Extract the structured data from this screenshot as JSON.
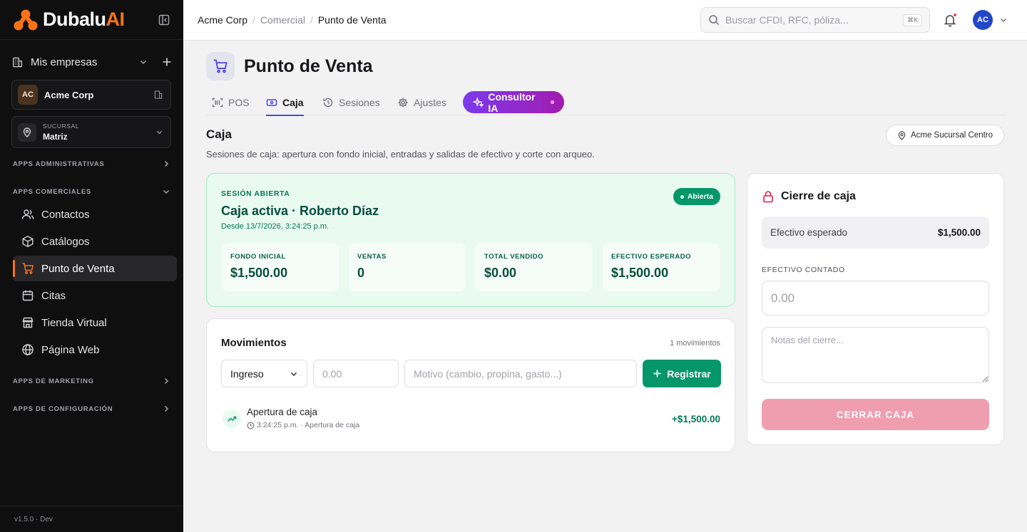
{
  "brand": {
    "name": "Dubalu",
    "suffix": "AI",
    "accent": "#f97316"
  },
  "sidebar": {
    "companies_label": "Mis empresas",
    "company": {
      "initials": "AC",
      "name": "Acme Corp"
    },
    "branch": {
      "caption": "SUCURSAL",
      "value": "Matriz"
    },
    "sections": {
      "admin": "APPS ADMINISTRATIVAS",
      "commercial": "APPS COMERCIALES",
      "marketing": "APPS DE MARKETING",
      "config": "APPS DE CONFIGURACIÓN"
    },
    "items": [
      {
        "label": "Contactos",
        "icon": "users-icon"
      },
      {
        "label": "Catálogos",
        "icon": "box-icon"
      },
      {
        "label": "Punto de Venta",
        "icon": "cart-icon",
        "active": true
      },
      {
        "label": "Citas",
        "icon": "calendar-icon"
      },
      {
        "label": "Tienda Virtual",
        "icon": "store-icon"
      },
      {
        "label": "Página Web",
        "icon": "globe-icon"
      }
    ],
    "version": "v1.5.0 · Dev"
  },
  "topbar": {
    "breadcrumb": [
      "Acme Corp",
      "Comercial",
      "Punto de Venta"
    ],
    "search_placeholder": "Buscar CFDI, RFC, póliza...",
    "search_shortcut": "⌘K",
    "user_initials": "AC"
  },
  "page": {
    "title": "Punto de Venta",
    "tabs": [
      "POS",
      "Caja",
      "Sesiones",
      "Ajustes"
    ],
    "active_tab": "Caja",
    "ai_tab": "Consultor IA"
  },
  "caja": {
    "title": "Caja",
    "description": "Sesiones de caja: apertura con fondo inicial, entradas y salidas de efectivo y corte con arqueo.",
    "branch_pill": "Acme Sucursal Centro",
    "session": {
      "caption": "SESIÓN ABIERTA",
      "title": "Caja activa · Roberto Díaz",
      "since": "Desde 13/7/2026, 3:24:25 p.m.",
      "status": "Abierta",
      "stats": [
        {
          "label": "FONDO INICIAL",
          "value": "$1,500.00"
        },
        {
          "label": "VENTAS",
          "value": "0"
        },
        {
          "label": "TOTAL VENDIDO",
          "value": "$0.00"
        },
        {
          "label": "EFECTIVO ESPERADO",
          "value": "$1,500.00"
        }
      ]
    },
    "movements": {
      "title": "Movimientos",
      "count": "1 movimientos",
      "type_selected": "Ingreso",
      "amount_placeholder": "0.00",
      "reason_placeholder": "Motivo (cambio, propina, gasto...)",
      "register_label": "Registrar",
      "rows": [
        {
          "name": "Apertura de caja",
          "meta": "3:24:25 p.m. · Apertura de caja",
          "amount": "+$1,500.00"
        }
      ]
    },
    "close": {
      "title": "Cierre de caja",
      "expected_label": "Efectivo esperado",
      "expected_value": "$1,500.00",
      "counted_label": "EFECTIVO CONTADO",
      "counted_placeholder": "0.00",
      "notes_placeholder": "Notas del cierre...",
      "button_label": "CERRAR CAJA"
    }
  }
}
